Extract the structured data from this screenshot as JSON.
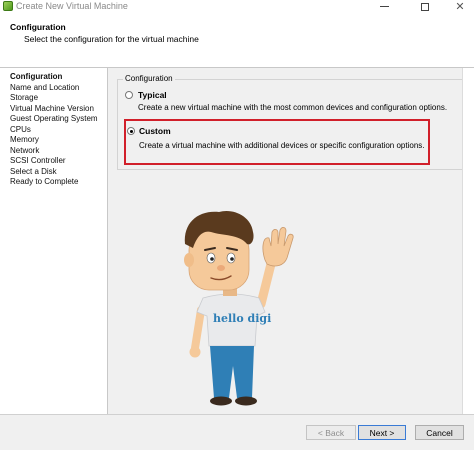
{
  "window": {
    "title": "Create New Virtual Machine"
  },
  "header": {
    "title": "Configuration",
    "subtitle": "Select the configuration for the virtual machine"
  },
  "steps": [
    {
      "label": "Configuration",
      "active": true
    },
    {
      "label": "Name and Location",
      "active": false
    },
    {
      "label": "Storage",
      "active": false
    },
    {
      "label": "Virtual Machine Version",
      "active": false
    },
    {
      "label": "Guest Operating System",
      "active": false
    },
    {
      "label": "CPUs",
      "active": false
    },
    {
      "label": "Memory",
      "active": false
    },
    {
      "label": "Network",
      "active": false
    },
    {
      "label": "SCSI Controller",
      "active": false
    },
    {
      "label": "Select a Disk",
      "active": false
    },
    {
      "label": "Ready to Complete",
      "active": false
    }
  ],
  "config": {
    "group_label": "Configuration",
    "options": [
      {
        "label": "Typical",
        "description": "Create a new virtual machine with the most common devices and configuration options.",
        "selected": false
      },
      {
        "label": "Custom",
        "description": "Create a virtual machine with additional devices or specific configuration options.",
        "selected": true
      }
    ]
  },
  "mascot": {
    "shirt_text": "hello digi"
  },
  "footer": {
    "back_label": "< Back",
    "next_label": "Next >",
    "cancel_label": "Cancel"
  },
  "colors": {
    "highlight": "#d11f2a",
    "panel_bg": "#f0f0f0",
    "shirt": "#e9eaec",
    "pants": "#2f7fb6",
    "hair": "#5a3a1e",
    "skin": "#f5c99a"
  }
}
